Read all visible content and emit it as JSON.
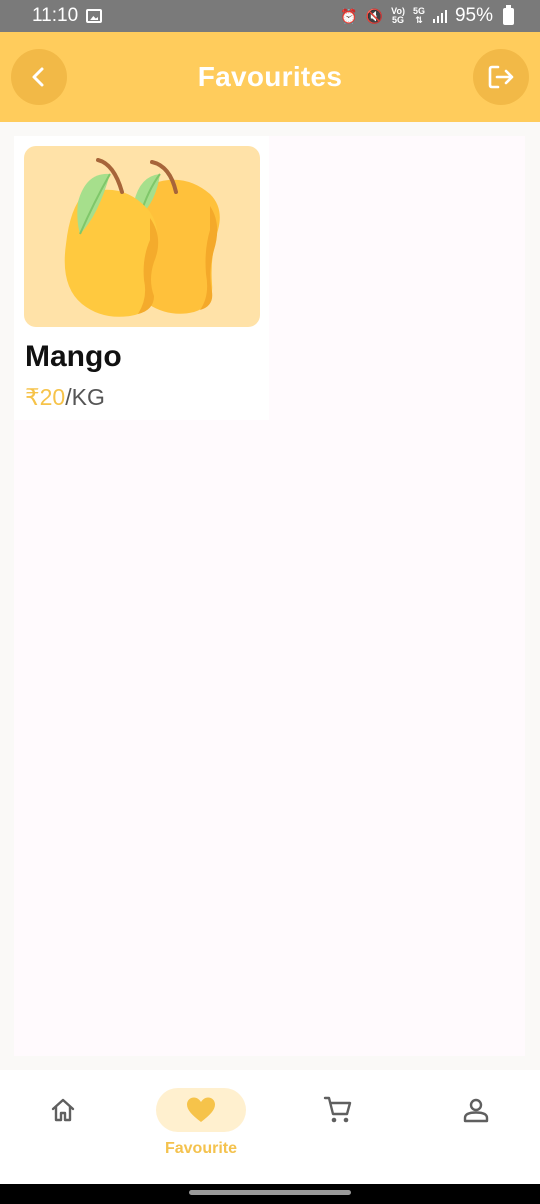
{
  "status_bar": {
    "time": "11:10",
    "volte_top": "Vo)",
    "volte_bottom": "5G",
    "network_top": "5G",
    "network_bottom": "⇅",
    "battery": "95%"
  },
  "header": {
    "title": "Favourites"
  },
  "favourites": [
    {
      "name": "Mango",
      "price": "₹20",
      "unit": "/KG"
    }
  ],
  "bottom_nav": {
    "items": [
      {
        "id": "home",
        "label": "",
        "icon": "home-icon"
      },
      {
        "id": "favourite",
        "label": "Favourite",
        "icon": "heart-icon",
        "active": true
      },
      {
        "id": "cart",
        "label": "",
        "icon": "cart-icon"
      },
      {
        "id": "profile",
        "label": "",
        "icon": "profile-icon"
      }
    ]
  },
  "colors": {
    "header": "#ffcc5c",
    "header_button": "#f2b947",
    "accent": "#f6c34a",
    "image_bg": "#ffe2a8",
    "nav_active_bg": "#fff0cf"
  }
}
